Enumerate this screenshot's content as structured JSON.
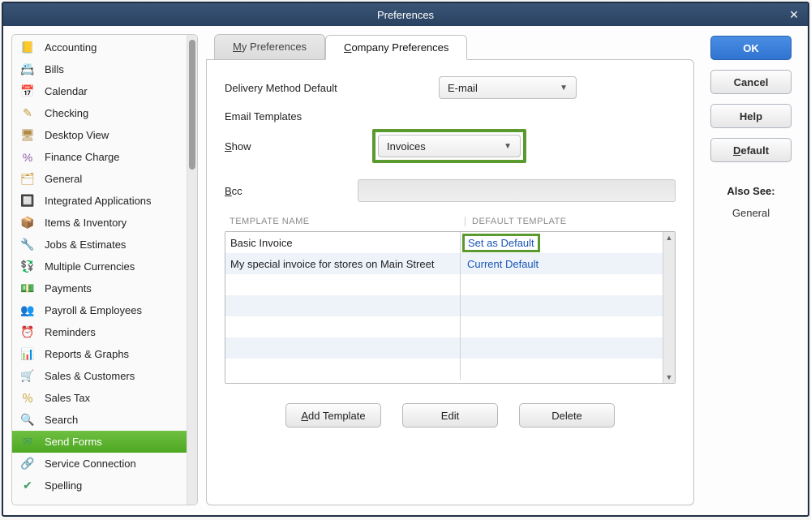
{
  "window": {
    "title": "Preferences"
  },
  "sidebar": {
    "items": [
      {
        "label": "Accounting",
        "icon": "📒",
        "color": "#d9a531"
      },
      {
        "label": "Bills",
        "icon": "📇",
        "color": "#357ab7"
      },
      {
        "label": "Calendar",
        "icon": "📅",
        "color": "#5b6b80"
      },
      {
        "label": "Checking",
        "icon": "✎",
        "color": "#c09a3b"
      },
      {
        "label": "Desktop View",
        "icon": "🖥",
        "color": "#b08b46"
      },
      {
        "label": "Finance Charge",
        "icon": "%",
        "color": "#8b5fa6"
      },
      {
        "label": "General",
        "icon": "🗂",
        "color": "#c89b3a"
      },
      {
        "label": "Integrated Applications",
        "icon": "🔲",
        "color": "#4f7c3c"
      },
      {
        "label": "Items & Inventory",
        "icon": "📦",
        "color": "#caa23a"
      },
      {
        "label": "Jobs & Estimates",
        "icon": "🔧",
        "color": "#c1953a"
      },
      {
        "label": "Multiple Currencies",
        "icon": "💱",
        "color": "#3f9a64"
      },
      {
        "label": "Payments",
        "icon": "💵",
        "color": "#3f9a64"
      },
      {
        "label": "Payroll & Employees",
        "icon": "👥",
        "color": "#3f9a64"
      },
      {
        "label": "Reminders",
        "icon": "⏰",
        "color": "#e0a82c"
      },
      {
        "label": "Reports & Graphs",
        "icon": "📊",
        "color": "#3f9a64"
      },
      {
        "label": "Sales & Customers",
        "icon": "🛒",
        "color": "#c89b3a"
      },
      {
        "label": "Sales Tax",
        "icon": "％",
        "color": "#caa23a"
      },
      {
        "label": "Search",
        "icon": "🔍",
        "color": "#7a7a7a"
      },
      {
        "label": "Send Forms",
        "icon": "✉",
        "color": "#3f9a64",
        "active": true
      },
      {
        "label": "Service Connection",
        "icon": "🔗",
        "color": "#5f8f3a"
      },
      {
        "label": "Spelling",
        "icon": "✔",
        "color": "#3f9a64"
      }
    ]
  },
  "tabs": {
    "my": "My Preferences",
    "company": "Company Preferences",
    "active": "company"
  },
  "form": {
    "delivery_method_label": "Delivery Method Default",
    "delivery_method_value": "E-mail",
    "email_templates_label": "Email Templates",
    "show_label": "Show",
    "show_value": "Invoices",
    "bcc_label": "Bcc",
    "bcc_value": ""
  },
  "table": {
    "header_name": "TEMPLATE NAME",
    "header_default": "DEFAULT TEMPLATE",
    "rows": [
      {
        "name": "Basic Invoice",
        "default": "Set as Default",
        "highlight": true
      },
      {
        "name": "My special invoice for stores on Main Street",
        "default": "Current Default"
      }
    ]
  },
  "bottom_buttons": {
    "add": "Add Template",
    "edit": "Edit",
    "delete": "Delete"
  },
  "right_buttons": {
    "ok": "OK",
    "cancel": "Cancel",
    "help": "Help",
    "default": "Default"
  },
  "also_see": {
    "header": "Also See:",
    "links": [
      "General"
    ]
  }
}
